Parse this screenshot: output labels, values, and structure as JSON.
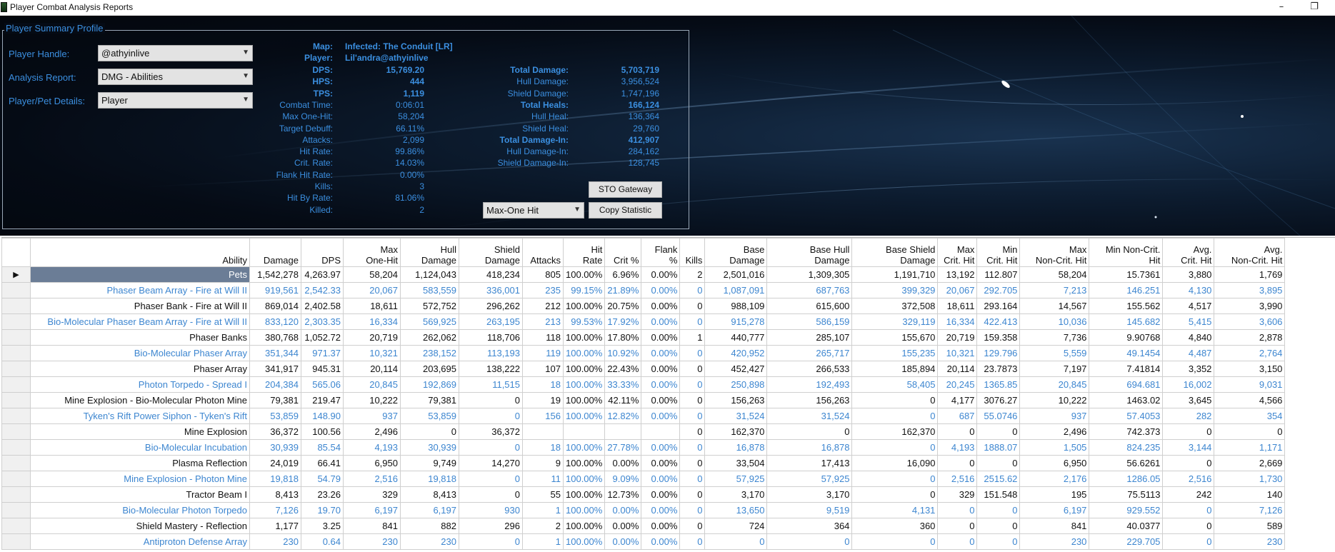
{
  "window": {
    "title": "Player Combat Analysis Reports",
    "minimize_glyph": "–",
    "restore_glyph": "❐",
    "icon": "app-icon"
  },
  "profile": {
    "legend": "Player Summary Profile",
    "player_handle_label": "Player Handle:",
    "player_handle_value": "@athyinlive",
    "analysis_report_label": "Analysis Report:",
    "analysis_report_value": "DMG - Abilities",
    "details_label": "Player/Pet Details:",
    "details_value": "Player"
  },
  "summary": {
    "map_label": "Map:",
    "map_value": "Infected: The Conduit [LR]",
    "player_label": "Player:",
    "player_value": "Lil'andra@athyinlive",
    "left_stats": [
      {
        "label": "DPS:",
        "value": "15,769.20",
        "bold": true
      },
      {
        "label": "HPS:",
        "value": "444",
        "bold": true
      },
      {
        "label": "TPS:",
        "value": "1,119",
        "bold": true
      },
      {
        "label": "Combat Time:",
        "value": "0:06:01",
        "bold": false
      },
      {
        "label": "Max One-Hit:",
        "value": "58,204",
        "bold": false
      },
      {
        "label": "Target Debuff:",
        "value": "66.11%",
        "bold": false
      },
      {
        "label": "Attacks:",
        "value": "2,099",
        "bold": false
      },
      {
        "label": "Hit Rate:",
        "value": "99.86%",
        "bold": false
      },
      {
        "label": "Crit. Rate:",
        "value": "14.03%",
        "bold": false
      },
      {
        "label": "Flank Hit Rate:",
        "value": "0.00%",
        "bold": false
      },
      {
        "label": "Kills:",
        "value": "3",
        "bold": false
      },
      {
        "label": "Hit By Rate:",
        "value": "81.06%",
        "bold": false
      },
      {
        "label": "Killed:",
        "value": "2",
        "bold": false
      }
    ],
    "right_stats": [
      {
        "label": "Total Damage:",
        "value": "5,703,719",
        "bold": true
      },
      {
        "label": "Hull Damage:",
        "value": "3,956,524",
        "bold": false
      },
      {
        "label": "Shield Damage:",
        "value": "1,747,196",
        "bold": false
      },
      {
        "label": "Total Heals:",
        "value": "166,124",
        "bold": true
      },
      {
        "label": "Hull Heal:",
        "value": "136,364",
        "bold": false
      },
      {
        "label": "Shield Heal:",
        "value": "29,760",
        "bold": false
      },
      {
        "label": "Total Damage-In:",
        "value": "412,907",
        "bold": true
      },
      {
        "label": "Hull Damage-In:",
        "value": "284,162",
        "bold": false
      },
      {
        "label": "Shield Damage-In:",
        "value": "128,745",
        "bold": false
      }
    ],
    "gateway_button": "STO Gateway",
    "statistic_select": "Max-One Hit",
    "copy_button": "Copy Statistic",
    "accent_color": "#3b8fe0"
  },
  "table": {
    "row_indicator": "▶",
    "columns": [
      "Ability",
      "Damage",
      "DPS",
      "Max\nOne-Hit",
      "Hull\nDamage",
      "Shield\nDamage",
      "Attacks",
      "Hit\nRate",
      "Crit %",
      "Flank\n%",
      "Kills",
      "Base\nDamage",
      "Base Hull\nDamage",
      "Base Shield\nDamage",
      "Max\nCrit. Hit",
      "Min\nCrit. Hit",
      "Max\nNon-Crit. Hit",
      "Min Non-Crit.\nHit",
      "Avg.\nCrit. Hit",
      "Avg.\nNon-Crit. Hit"
    ],
    "rows": [
      [
        "Pets",
        "1,542,278",
        "4,263.97",
        "58,204",
        "1,124,043",
        "418,234",
        "805",
        "100.00%",
        "6.96%",
        "0.00%",
        "2",
        "2,501,016",
        "1,309,305",
        "1,191,710",
        "13,192",
        "112.807",
        "58,204",
        "15.7361",
        "3,880",
        "1,769"
      ],
      [
        "Phaser Beam Array - Fire at Will II",
        "919,561",
        "2,542.33",
        "20,067",
        "583,559",
        "336,001",
        "235",
        "99.15%",
        "21.89%",
        "0.00%",
        "0",
        "1,087,091",
        "687,763",
        "399,329",
        "20,067",
        "292.705",
        "7,213",
        "146.251",
        "4,130",
        "3,895"
      ],
      [
        "Phaser Bank - Fire at Will II",
        "869,014",
        "2,402.58",
        "18,611",
        "572,752",
        "296,262",
        "212",
        "100.00%",
        "20.75%",
        "0.00%",
        "0",
        "988,109",
        "615,600",
        "372,508",
        "18,611",
        "293.164",
        "14,567",
        "155.562",
        "4,517",
        "3,990"
      ],
      [
        "Bio-Molecular Phaser Beam Array - Fire at Will II",
        "833,120",
        "2,303.35",
        "16,334",
        "569,925",
        "263,195",
        "213",
        "99.53%",
        "17.92%",
        "0.00%",
        "0",
        "915,278",
        "586,159",
        "329,119",
        "16,334",
        "422.413",
        "10,036",
        "145.682",
        "5,415",
        "3,606"
      ],
      [
        "Phaser Banks",
        "380,768",
        "1,052.72",
        "20,719",
        "262,062",
        "118,706",
        "118",
        "100.00%",
        "17.80%",
        "0.00%",
        "1",
        "440,777",
        "285,107",
        "155,670",
        "20,719",
        "159.358",
        "7,736",
        "9.90768",
        "4,840",
        "2,878"
      ],
      [
        "Bio-Molecular Phaser Array",
        "351,344",
        "971.37",
        "10,321",
        "238,152",
        "113,193",
        "119",
        "100.00%",
        "10.92%",
        "0.00%",
        "0",
        "420,952",
        "265,717",
        "155,235",
        "10,321",
        "129.796",
        "5,559",
        "49.1454",
        "4,487",
        "2,764"
      ],
      [
        "Phaser Array",
        "341,917",
        "945.31",
        "20,114",
        "203,695",
        "138,222",
        "107",
        "100.00%",
        "22.43%",
        "0.00%",
        "0",
        "452,427",
        "266,533",
        "185,894",
        "20,114",
        "23.7873",
        "7,197",
        "7.41814",
        "3,352",
        "3,150"
      ],
      [
        "Photon Torpedo - Spread I",
        "204,384",
        "565.06",
        "20,845",
        "192,869",
        "11,515",
        "18",
        "100.00%",
        "33.33%",
        "0.00%",
        "0",
        "250,898",
        "192,493",
        "58,405",
        "20,245",
        "1365.85",
        "20,845",
        "694.681",
        "16,002",
        "9,031"
      ],
      [
        "Mine Explosion - Bio-Molecular Photon Mine",
        "79,381",
        "219.47",
        "10,222",
        "79,381",
        "0",
        "19",
        "100.00%",
        "42.11%",
        "0.00%",
        "0",
        "156,263",
        "156,263",
        "0",
        "4,177",
        "3076.27",
        "10,222",
        "1463.02",
        "3,645",
        "4,566"
      ],
      [
        "Tyken's Rift Power Siphon - Tyken's Rift",
        "53,859",
        "148.90",
        "937",
        "53,859",
        "0",
        "156",
        "100.00%",
        "12.82%",
        "0.00%",
        "0",
        "31,524",
        "31,524",
        "0",
        "687",
        "55.0746",
        "937",
        "57.4053",
        "282",
        "354"
      ],
      [
        "Mine Explosion",
        "36,372",
        "100.56",
        "2,496",
        "0",
        "36,372",
        "",
        "",
        "",
        "",
        "0",
        "162,370",
        "0",
        "162,370",
        "0",
        "0",
        "2,496",
        "742.373",
        "0",
        "0"
      ],
      [
        "Bio-Molecular Incubation",
        "30,939",
        "85.54",
        "4,193",
        "30,939",
        "0",
        "18",
        "100.00%",
        "27.78%",
        "0.00%",
        "0",
        "16,878",
        "16,878",
        "0",
        "4,193",
        "1888.07",
        "1,505",
        "824.235",
        "3,144",
        "1,171"
      ],
      [
        "Plasma Reflection",
        "24,019",
        "66.41",
        "6,950",
        "9,749",
        "14,270",
        "9",
        "100.00%",
        "0.00%",
        "0.00%",
        "0",
        "33,504",
        "17,413",
        "16,090",
        "0",
        "0",
        "6,950",
        "56.6261",
        "0",
        "2,669"
      ],
      [
        "Mine Explosion - Photon Mine",
        "19,818",
        "54.79",
        "2,516",
        "19,818",
        "0",
        "11",
        "100.00%",
        "9.09%",
        "0.00%",
        "0",
        "57,925",
        "57,925",
        "0",
        "2,516",
        "2515.62",
        "2,176",
        "1286.05",
        "2,516",
        "1,730"
      ],
      [
        "Tractor Beam I",
        "8,413",
        "23.26",
        "329",
        "8,413",
        "0",
        "55",
        "100.00%",
        "12.73%",
        "0.00%",
        "0",
        "3,170",
        "3,170",
        "0",
        "329",
        "151.548",
        "195",
        "75.5113",
        "242",
        "140"
      ],
      [
        "Bio-Molecular Photon Torpedo",
        "7,126",
        "19.70",
        "6,197",
        "6,197",
        "930",
        "1",
        "100.00%",
        "0.00%",
        "0.00%",
        "0",
        "13,650",
        "9,519",
        "4,131",
        "0",
        "0",
        "6,197",
        "929.552",
        "0",
        "7,126"
      ],
      [
        "Shield Mastery - Reflection",
        "1,177",
        "3.25",
        "841",
        "882",
        "296",
        "2",
        "100.00%",
        "0.00%",
        "0.00%",
        "0",
        "724",
        "364",
        "360",
        "0",
        "0",
        "841",
        "40.0377",
        "0",
        "589"
      ],
      [
        "Antiproton Defense Array",
        "230",
        "0.64",
        "230",
        "230",
        "0",
        "1",
        "100.00%",
        "0.00%",
        "0.00%",
        "0",
        "0",
        "0",
        "0",
        "0",
        "0",
        "230",
        "229.705",
        "0",
        "230"
      ]
    ],
    "colors": {
      "odd_text": "#111111",
      "even_text": "#3d86d0",
      "selected_bg": "#6b7d96"
    }
  }
}
